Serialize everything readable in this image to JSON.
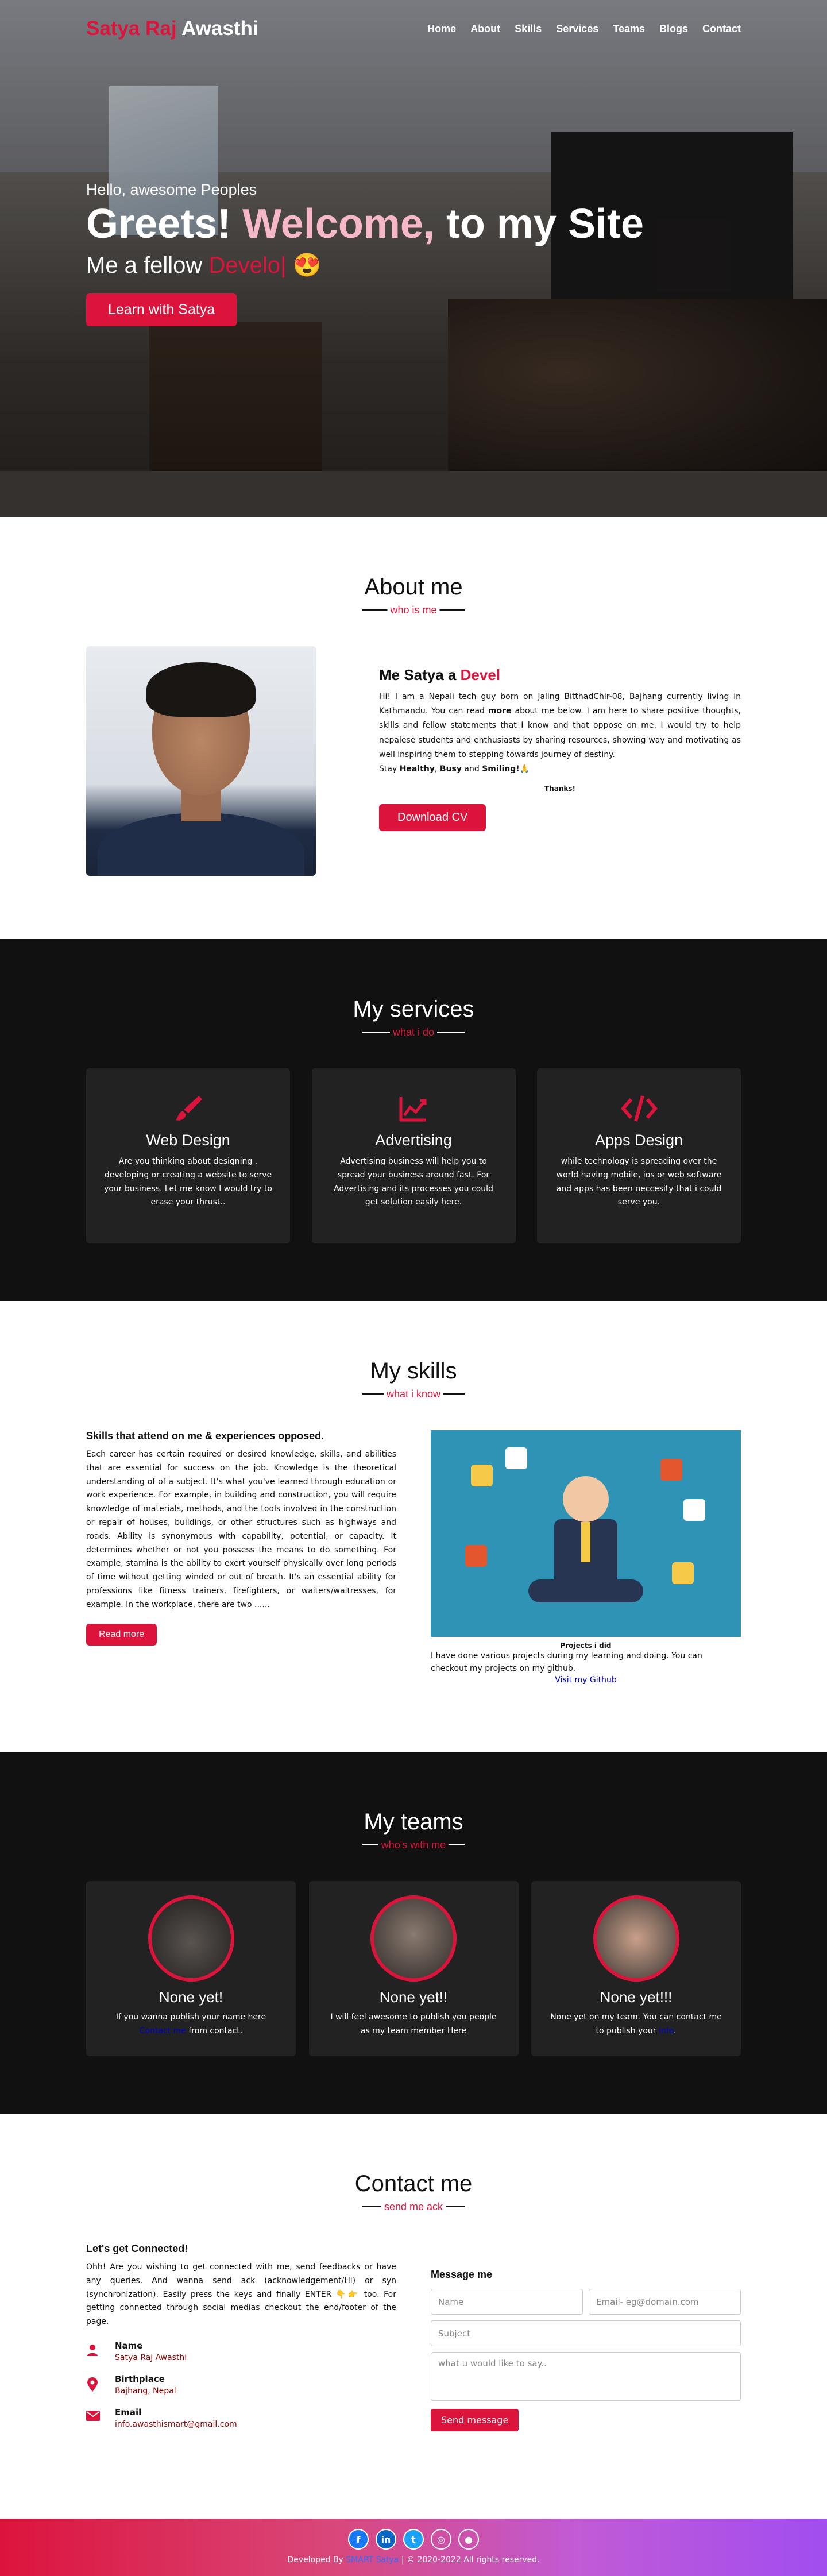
{
  "nav": {
    "logo_first": "Satya Raj",
    "logo_last": "Awasthi",
    "items": [
      "Home",
      "About",
      "Skills",
      "Services",
      "Teams",
      "Blogs",
      "Contact"
    ]
  },
  "hero": {
    "greeting": "Hello, awesome Peoples",
    "headline_1": "Greets!",
    "headline_2": "Welcome,",
    "headline_3": "to my Site",
    "tagline_prefix": "Me a fellow",
    "tagline_typed": "Develo|",
    "tagline_emoji": "😍",
    "button": "Learn with Satya"
  },
  "about": {
    "title": "About me",
    "subtitle": "who is me",
    "name_prefix": "Me Satya a",
    "name_typed": "Devel",
    "para_1": "Hi! I am a Nepali tech guy born on Jaling BitthadChir-08, Bajhang currently living in Kathmandu. You can read",
    "para_bold": "more",
    "para_2": "about me below. I am here to share positive thoughts, skills and fellow statements that I know and that oppose on me. I would try to help nepalese students and enthusiasts by sharing resources, showing way and motivating as well inspiring them to stepping towards journey of destiny.",
    "stay_prefix": "Stay",
    "stay_1": "Healthy",
    "stay_2": "Busy",
    "stay_3": "Smiling!",
    "stay_emoji": "🙏",
    "thanks": "Thanks!",
    "button": "Download CV"
  },
  "services": {
    "title": "My services",
    "subtitle": "what i do",
    "cards": [
      {
        "title": "Web Design",
        "text": "Are you thinking about designing , developing or creating a website to serve your business. Let me know I would try to erase your thrust..",
        "icon": "paintbrush-icon"
      },
      {
        "title": "Advertising",
        "text": "Advertising business will help you to spread your business around fast. For Advertising and its processes you could get solution easily here.",
        "icon": "chart-line-icon"
      },
      {
        "title": "Apps Design",
        "text": "while technology is spreading over the world having mobile, ios or web software and apps has been neccesity that i could serve you.",
        "icon": "code-icon"
      }
    ]
  },
  "skills": {
    "title": "My skills",
    "subtitle": "what i know",
    "heading": "Skills that attend on me & experiences opposed.",
    "body": "Each career has certain required or desired knowledge, skills, and abilities that are essential for success on the job. Knowledge is the theoretical understanding of of a subject. It's what you've learned through education or work experience. For example, in building and construction, you will require knowledge of materials, methods, and the tools involved in the construction or repair of houses, buildings, or other structures such as highways and roads. Ability is synonymous with capability, potential, or capacity. It determines whether or not you possess the means to do something. For example, stamina is the ability to exert yourself physically over long periods of time without getting winded or out of breath. It's an essential ability for professions like fitness trainers, firefighters, or waiters/waitresses, for example. In the workplace, there are two ......",
    "button": "Read more",
    "caption": "Projects i did",
    "projects_text": "I have done various projects during my learning and doing. You can checkout my projects on my github.",
    "github_link": "Visit my Github"
  },
  "teams": {
    "title": "My teams",
    "subtitle": "who's with me",
    "members": [
      {
        "name": "None yet!",
        "text_1": "If you wanna publish your name here",
        "link": "Contact me",
        "text_2": "from contact."
      },
      {
        "name": "None yet!!",
        "text_1": "I will feel awesome to publish you people as my team member Here",
        "link": "",
        "text_2": ""
      },
      {
        "name": "None yet!!!",
        "text_1": "None yet on my team. You can contact me to publish your",
        "link": "info",
        "text_2": "."
      }
    ]
  },
  "contact": {
    "title": "Contact me",
    "subtitle": "send me ack",
    "heading": "Let's get Connected!",
    "body": "Ohh! Are you wishing to get connected with me, send feedbacks or have any queries. And wanna send ack (acknowledgement/Hi) or syn (synchronization). Easily press the keys and finally ENTER 👇👉 too. For getting connected through social medias checkout the end/footer of the page.",
    "info": [
      {
        "label": "Name",
        "value": "Satya Raj Awasthi",
        "icon": "person-icon"
      },
      {
        "label": "Birthplace",
        "value": "Bajhang, Nepal",
        "icon": "map-marker-icon"
      },
      {
        "label": "Email",
        "value": "info.awasthismart@gmail.com",
        "icon": "envelope-icon"
      }
    ],
    "form_title": "Message me",
    "name_placeholder": "Name",
    "email_placeholder": "Email- eg@domain.com",
    "subject_placeholder": "Subject",
    "message_placeholder": "what u would like to say..",
    "send_button": "Send message"
  },
  "footer": {
    "prefix": "Developed By",
    "author": "SMART Satya",
    "suffix": "| © 2020-2022 All rights reserved.",
    "socials": [
      "facebook-icon",
      "linkedin-icon",
      "twitter-icon",
      "instagram-icon",
      "github-icon"
    ]
  },
  "colors": {
    "accent": "#dc143c",
    "subtitle": "#dc143c",
    "dark_bg": "#111111",
    "card_bg": "#222222"
  }
}
